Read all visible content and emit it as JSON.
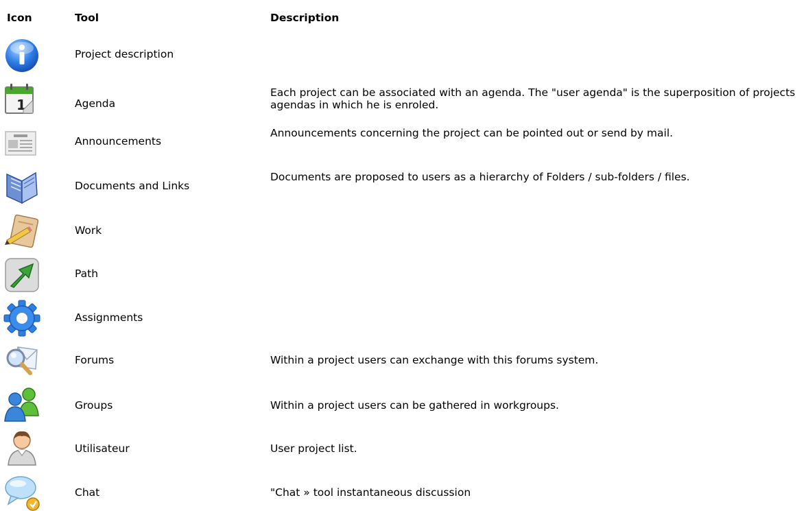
{
  "header": {
    "icon": "Icon",
    "tool": "Tool",
    "description": "Description"
  },
  "rows": [
    {
      "icon": "info-icon",
      "tool": "Project description",
      "description": ""
    },
    {
      "icon": "calendar-icon",
      "tool": "Agenda",
      "description": "Each project can be associated with an agenda. The \"user agenda\" is the superposition of projects agendas in which he is enroled."
    },
    {
      "icon": "newspaper-icon",
      "tool": "Announcements",
      "description": "Announcements concerning the project can be pointed out or send by mail."
    },
    {
      "icon": "book-icon",
      "tool": "Documents and Links",
      "description": "Documents are proposed to users as a hierarchy of Folders / sub-folders / files."
    },
    {
      "icon": "pencil-paper-icon",
      "tool": "Work",
      "description": ""
    },
    {
      "icon": "green-arrow-icon",
      "tool": "Path",
      "description": ""
    },
    {
      "icon": "gear-icon",
      "tool": "Assignments",
      "description": ""
    },
    {
      "icon": "magnifier-envelope-icon",
      "tool": "Forums",
      "description": "Within a project users can exchange with this forums system."
    },
    {
      "icon": "users-group-icon",
      "tool": "Groups",
      "description": "Within a project users can be gathered in workgroups."
    },
    {
      "icon": "user-icon",
      "tool": "Utilisateur",
      "description": "User project list."
    },
    {
      "icon": "chat-bubble-icon",
      "tool": "Chat",
      "description": "\"Chat » tool  instantaneous discussion"
    }
  ]
}
